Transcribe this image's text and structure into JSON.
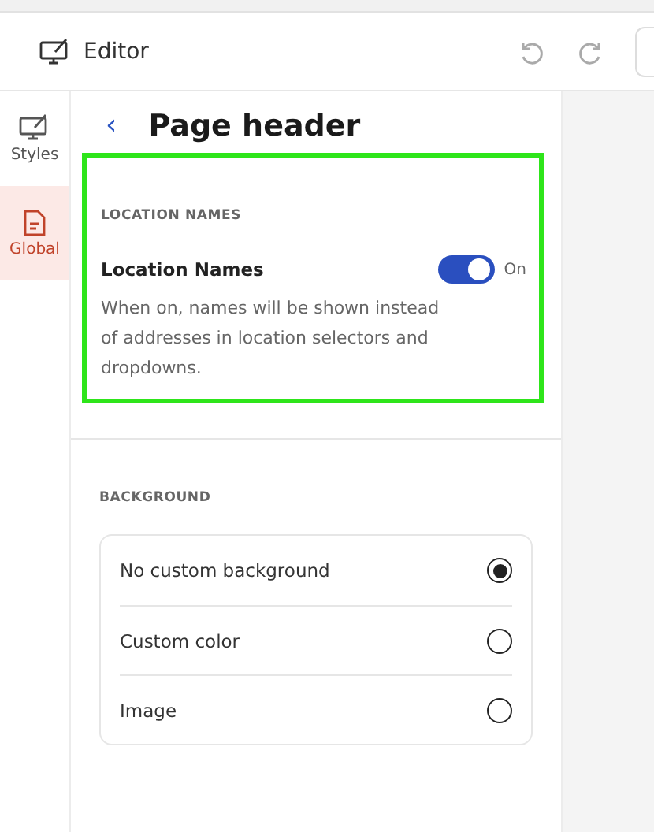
{
  "topbar": {
    "title": "Editor"
  },
  "sidebar": {
    "items": [
      {
        "label": "Styles",
        "kind": "styles",
        "selected": false
      },
      {
        "label": "Global",
        "kind": "global",
        "selected": true
      }
    ]
  },
  "panel": {
    "back": "‹",
    "title": "Page header",
    "location_names": {
      "section": "LOCATION NAMES",
      "label": "Location Names",
      "on": true,
      "state_text": "On",
      "description": "When on, names will be shown instead of addresses in location selectors and dropdowns.",
      "highlighted": true
    },
    "background": {
      "section": "BACKGROUND",
      "options": [
        {
          "label": "No custom background",
          "selected": true
        },
        {
          "label": "Custom color",
          "selected": false
        },
        {
          "label": "Image",
          "selected": false
        }
      ]
    }
  }
}
